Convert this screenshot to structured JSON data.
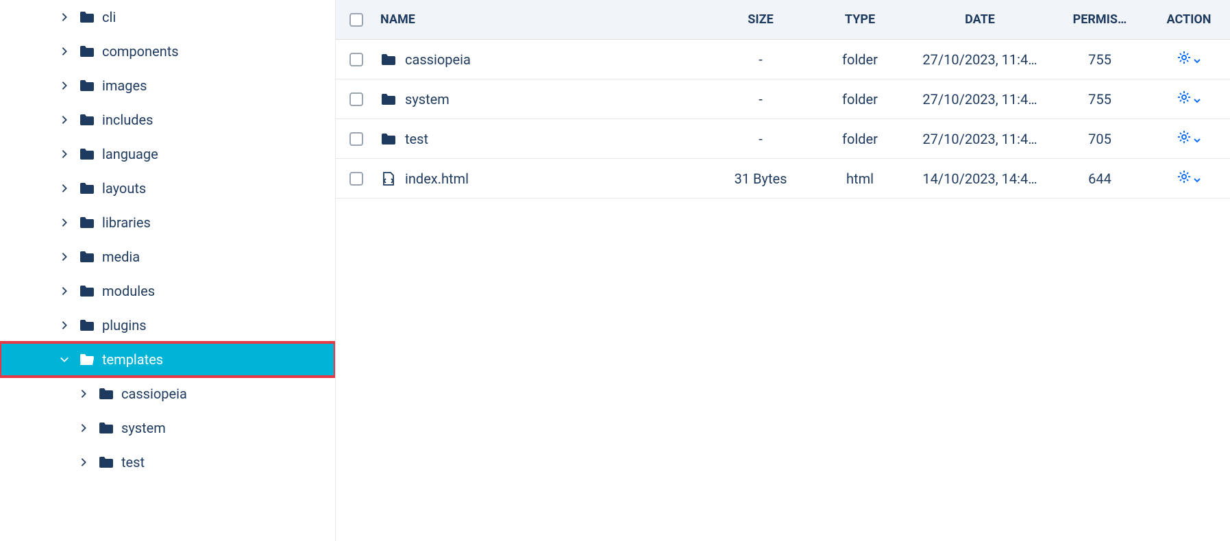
{
  "sidebar": {
    "items": [
      {
        "label": "cli",
        "expanded": false
      },
      {
        "label": "components",
        "expanded": false
      },
      {
        "label": "images",
        "expanded": false
      },
      {
        "label": "includes",
        "expanded": false
      },
      {
        "label": "language",
        "expanded": false
      },
      {
        "label": "layouts",
        "expanded": false
      },
      {
        "label": "libraries",
        "expanded": false
      },
      {
        "label": "media",
        "expanded": false
      },
      {
        "label": "modules",
        "expanded": false
      },
      {
        "label": "plugins",
        "expanded": false
      },
      {
        "label": "templates",
        "expanded": true,
        "selected": true,
        "highlight": true
      }
    ],
    "children": [
      {
        "label": "cassiopeia"
      },
      {
        "label": "system"
      },
      {
        "label": "test"
      }
    ]
  },
  "table": {
    "headers": {
      "name": "NAME",
      "size": "SIZE",
      "type": "TYPE",
      "date": "DATE",
      "permissions": "PERMIS…",
      "action": "ACTION"
    },
    "rows": [
      {
        "name": "cassiopeia",
        "size": "-",
        "type": "folder",
        "date": "27/10/2023, 11:4…",
        "perm": "755",
        "icon": "folder"
      },
      {
        "name": "system",
        "size": "-",
        "type": "folder",
        "date": "27/10/2023, 11:4…",
        "perm": "755",
        "icon": "folder"
      },
      {
        "name": "test",
        "size": "-",
        "type": "folder",
        "date": "27/10/2023, 11:4…",
        "perm": "705",
        "icon": "folder",
        "highlight": true
      },
      {
        "name": "index.html",
        "size": "31 Bytes",
        "type": "html",
        "date": "14/10/2023, 14:4…",
        "perm": "644",
        "icon": "file"
      }
    ]
  }
}
